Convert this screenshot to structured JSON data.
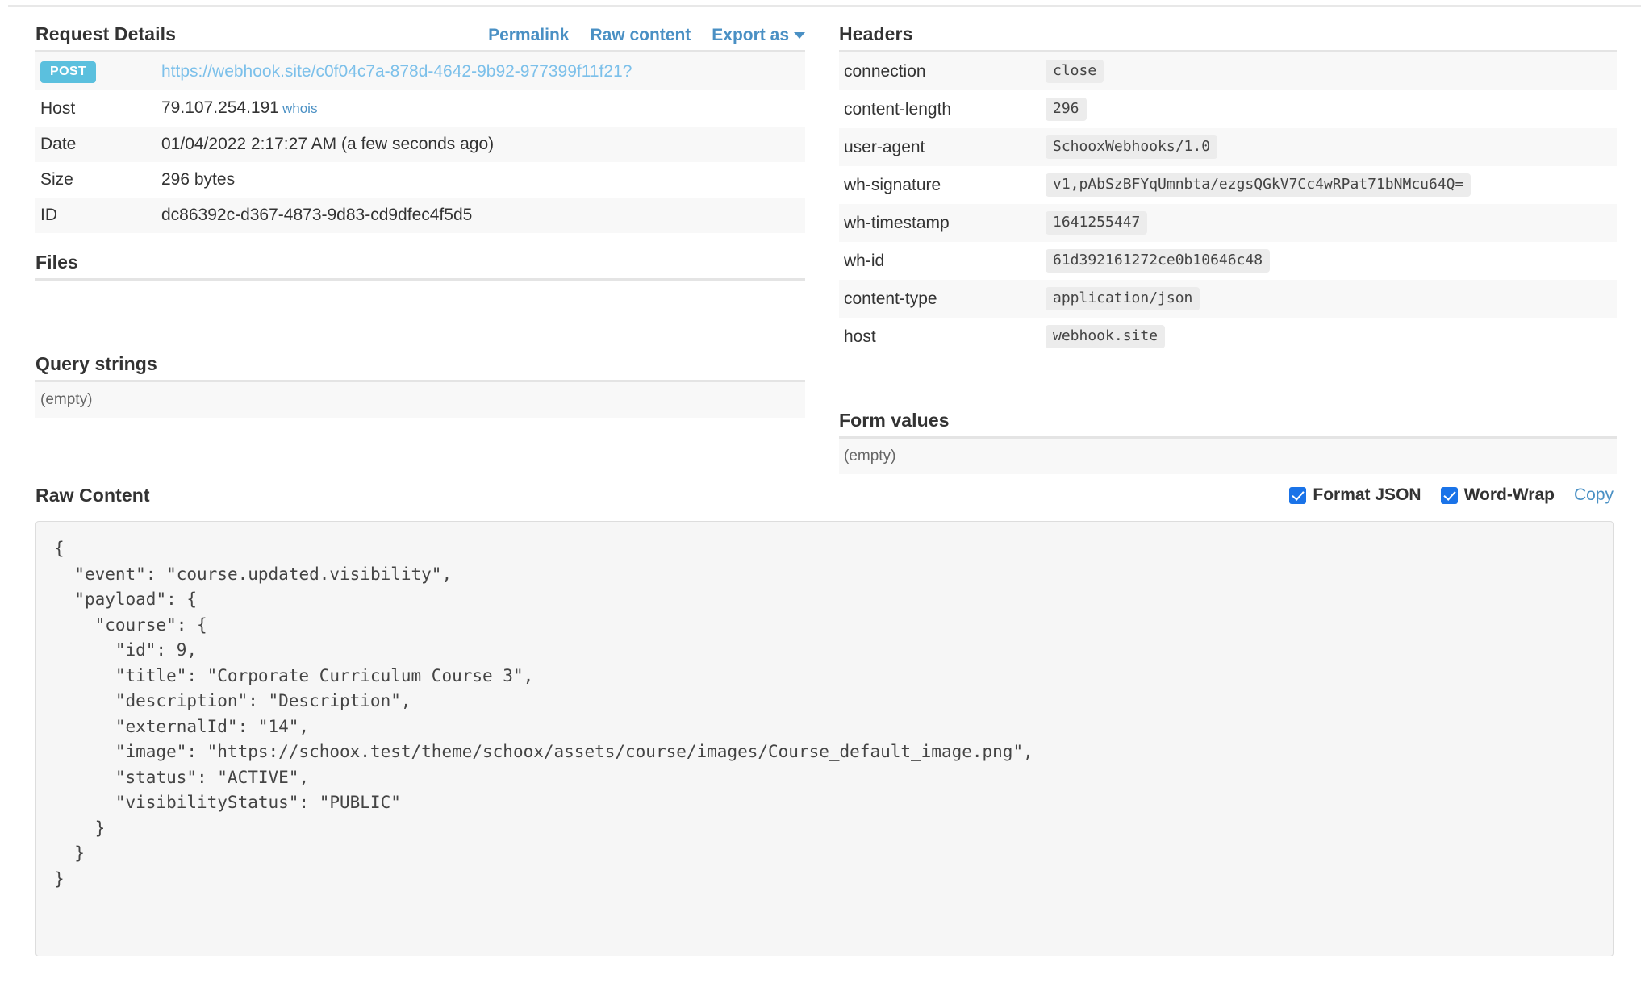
{
  "request_details": {
    "title": "Request Details",
    "actions": [
      {
        "label": "Permalink",
        "name": "permalink-link"
      },
      {
        "label": "Raw content",
        "name": "raw-content-link"
      },
      {
        "label": "Export as",
        "name": "export-as-dropdown"
      }
    ],
    "method_badge": "POST",
    "url": "https://webhook.site/c0f04c7a-878d-4642-9b92-977399f11f21?",
    "rows": [
      {
        "key": "Host",
        "value": "79.107.254.191",
        "suffix_link": "whois"
      },
      {
        "key": "Date",
        "value": "01/04/2022 2:17:27 AM (a few seconds ago)"
      },
      {
        "key": "Size",
        "value": "296 bytes"
      },
      {
        "key": "ID",
        "value": "dc86392c-d367-4873-9d83-cd9dfec4f5d5"
      }
    ]
  },
  "files": {
    "title": "Files"
  },
  "query_strings": {
    "title": "Query strings",
    "empty_text": "(empty)"
  },
  "headers": {
    "title": "Headers",
    "rows": [
      {
        "key": "connection",
        "value": "close"
      },
      {
        "key": "content-length",
        "value": "296"
      },
      {
        "key": "user-agent",
        "value": "SchooxWebhooks/1.0"
      },
      {
        "key": "wh-signature",
        "value": "v1,pAbSzBFYqUmnbta/ezgsQGkV7Cc4wRPat71bNMcu64Q="
      },
      {
        "key": "wh-timestamp",
        "value": "1641255447"
      },
      {
        "key": "wh-id",
        "value": "61d392161272ce0b10646c48"
      },
      {
        "key": "content-type",
        "value": "application/json"
      },
      {
        "key": "host",
        "value": "webhook.site"
      }
    ]
  },
  "form_values": {
    "title": "Form values",
    "empty_text": "(empty)"
  },
  "raw_content": {
    "title": "Raw Content",
    "format_json_label": "Format JSON",
    "word_wrap_label": "Word-Wrap",
    "copy_label": "Copy",
    "format_json_checked": true,
    "word_wrap_checked": true,
    "body": "{\n  \"event\": \"course.updated.visibility\",\n  \"payload\": {\n    \"course\": {\n      \"id\": 9,\n      \"title\": \"Corporate Curriculum Course 3\",\n      \"description\": \"Description\",\n      \"externalId\": \"14\",\n      \"image\": \"https://schoox.test/theme/schoox/assets/course/images/Course_default_image.png\",\n      \"status\": \"ACTIVE\",\n      \"visibilityStatus\": \"PUBLIC\"\n    }\n  }\n}"
  },
  "colors": {
    "accent_link": "#4a90c4",
    "badge_post": "#5bc0de",
    "checkbox": "#1a73e8",
    "row_stripe": "#f8f8f8",
    "rule": "#e4e4e4"
  }
}
